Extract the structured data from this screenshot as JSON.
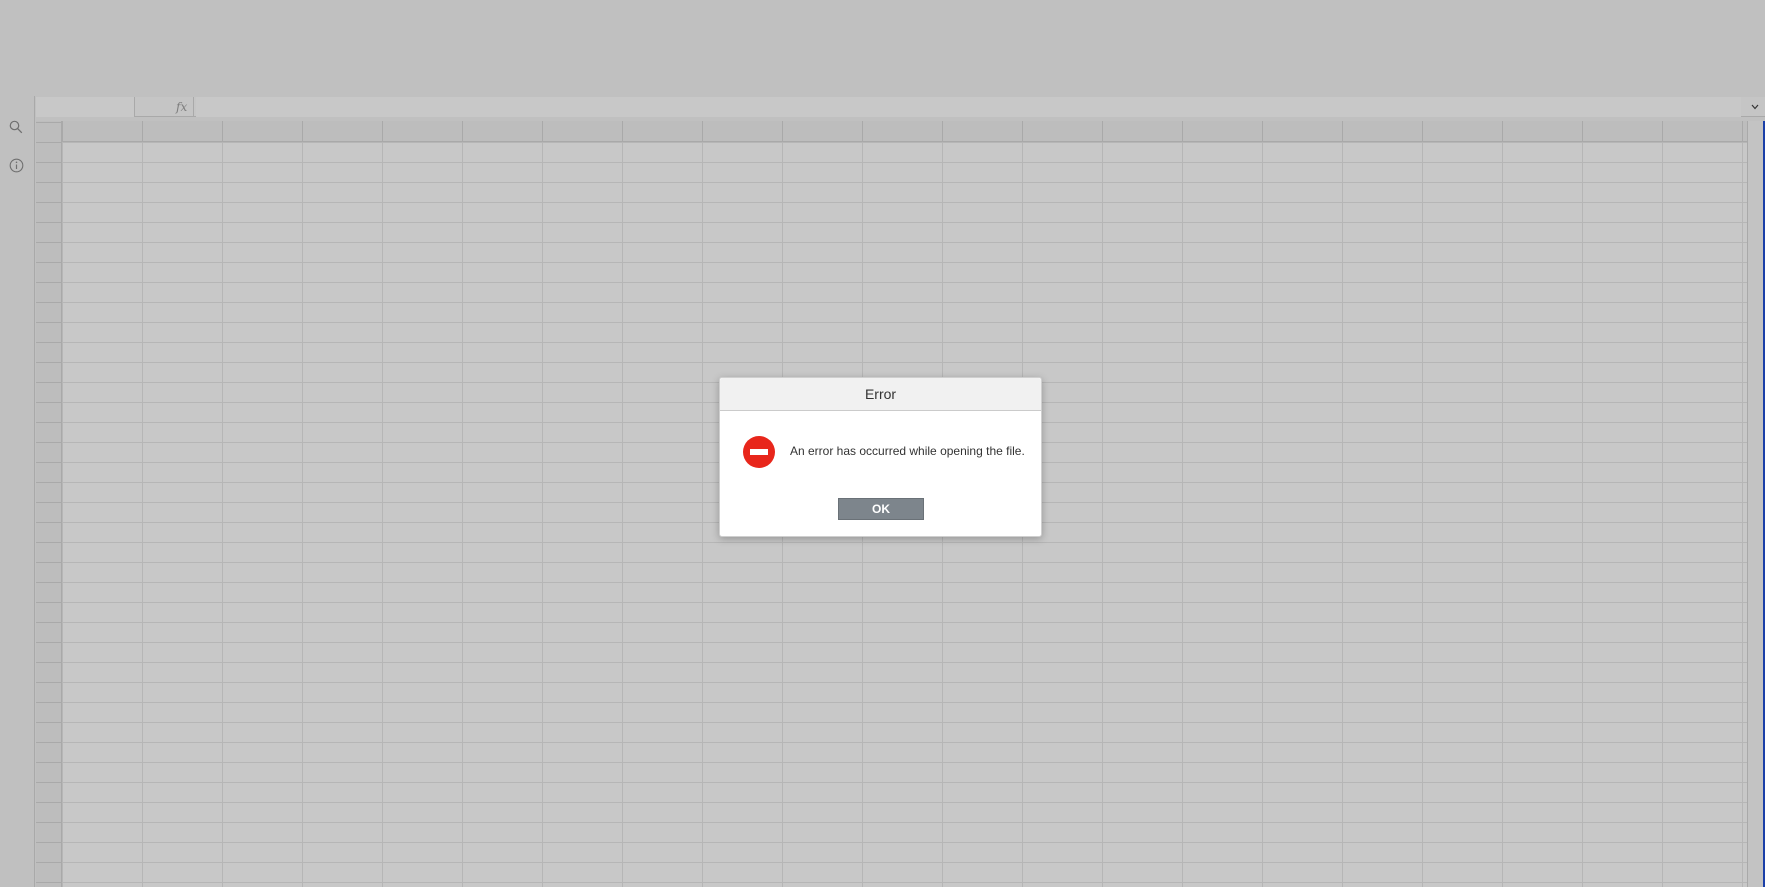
{
  "formula_bar": {
    "fx_label": "fx",
    "name_box_value": "",
    "formula_value": ""
  },
  "sidebar": {
    "items": [
      {
        "icon": "search-icon"
      },
      {
        "icon": "info-icon"
      }
    ]
  },
  "dialog": {
    "title": "Error",
    "message": "An error has occurred while opening the file.",
    "ok_label": "OK",
    "icon": "error-stop-icon",
    "icon_color": "#e8261b"
  },
  "colors": {
    "overlay_bg": "#c0c0c0",
    "ok_button_bg": "#7d858c",
    "dialog_header_bg": "#f1f1f1"
  }
}
